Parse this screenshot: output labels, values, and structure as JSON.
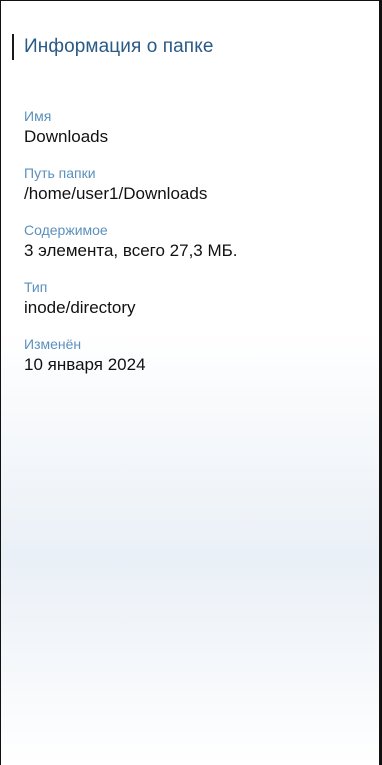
{
  "header": {
    "title": "Информация о папке"
  },
  "properties": [
    {
      "label": "Имя",
      "value": "Downloads"
    },
    {
      "label": "Путь папки",
      "value": "/home/user1/Downloads"
    },
    {
      "label": "Содержимое",
      "value": "3 элемента, всего 27,3 МБ."
    },
    {
      "label": "Тип",
      "value": "inode/directory"
    },
    {
      "label": "Изменён",
      "value": "10 января 2024"
    }
  ],
  "colors": {
    "title": "#2a5a86",
    "label": "#5b90bd",
    "value": "#111111"
  }
}
